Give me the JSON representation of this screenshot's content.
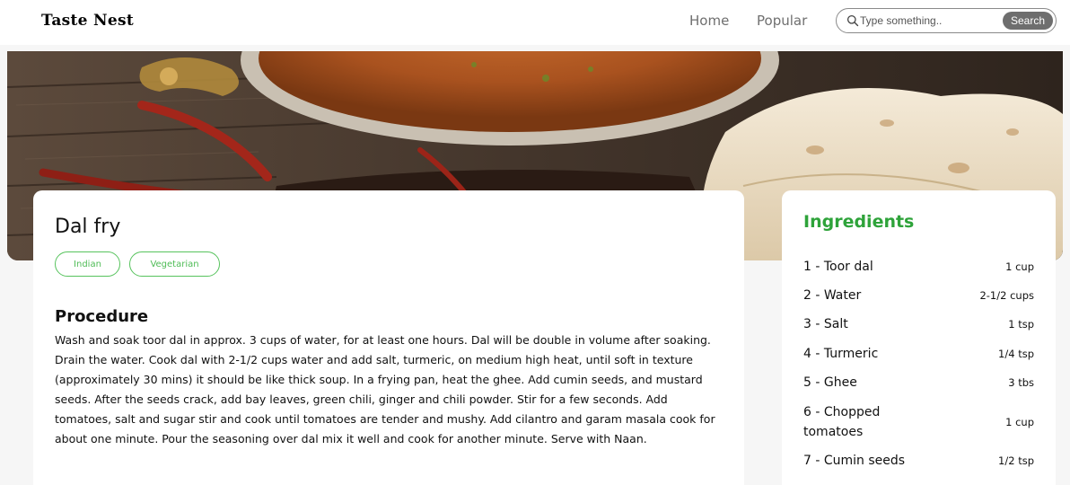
{
  "header": {
    "brand": "Taste Nest",
    "nav": {
      "home": "Home",
      "popular": "Popular"
    },
    "search": {
      "placeholder": "Type something..",
      "button_label": "Search"
    }
  },
  "hero": {
    "image": "dal-fry-hero-image"
  },
  "recipe": {
    "title": "Dal fry",
    "tags": [
      "Indian",
      "Vegetarian"
    ],
    "procedure_heading": "Procedure",
    "procedure_text": "Wash and soak toor dal in approx. 3 cups of water, for at least one hours. Dal will be double in volume after soaking. Drain the water. Cook dal with 2-1/2 cups water and add salt, turmeric, on medium high heat, until soft in texture (approximately 30 mins) it should be like thick soup. In a frying pan, heat the ghee. Add cumin seeds, and mustard seeds. After the seeds crack, add bay leaves, green chili, ginger and chili powder. Stir for a few seconds. Add tomatoes, salt and sugar stir and cook until tomatoes are tender and mushy. Add cilantro and garam masala cook for about one minute. Pour the seasoning over dal mix it well and cook for another minute. Serve with Naan."
  },
  "ingredients": {
    "heading": "Ingredients",
    "items": [
      {
        "name": "1 - Toor dal",
        "qty": "1 cup"
      },
      {
        "name": "2 - Water",
        "qty": "2-1/2 cups"
      },
      {
        "name": "3 - Salt",
        "qty": "1 tsp"
      },
      {
        "name": "4 - Turmeric",
        "qty": "1/4 tsp"
      },
      {
        "name": "5 - Ghee",
        "qty": "3 tbs"
      },
      {
        "name": "6 - Chopped tomatoes",
        "qty": "1 cup"
      },
      {
        "name": "7 - Cumin seeds",
        "qty": "1/2 tsp"
      }
    ]
  },
  "colors": {
    "accent_green": "#2ea33a",
    "tag_green": "#57c35d",
    "search_button": "#6e6e6e"
  }
}
